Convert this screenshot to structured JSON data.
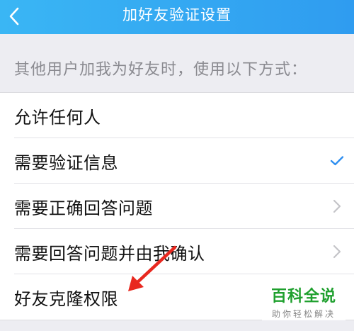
{
  "header": {
    "title": "加好友验证设置",
    "back_icon": "chevron-left-icon"
  },
  "section": {
    "description": "其他用户加我为好友时，使用以下方式："
  },
  "options": [
    {
      "label": "允许任何人",
      "indicator": "none",
      "selected": false
    },
    {
      "label": "需要验证信息",
      "indicator": "checkmark-icon",
      "selected": true
    },
    {
      "label": "需要正确回答问题",
      "indicator": "chevron-right-icon",
      "selected": false
    },
    {
      "label": "需要回答问题并由我确认",
      "indicator": "chevron-right-icon",
      "selected": false
    },
    {
      "label": "好友克隆权限",
      "indicator": "none",
      "selected": false
    }
  ],
  "annotation": {
    "icon": "red-arrow-icon",
    "color": "#e8281f"
  },
  "watermark": {
    "title": "百科全说",
    "subtitle": "助你轻松解决",
    "color": "#1fa02e"
  },
  "colors": {
    "header_bg": "#2f9cf0",
    "accent": "#2f8ff0",
    "background": "#ededf2"
  }
}
